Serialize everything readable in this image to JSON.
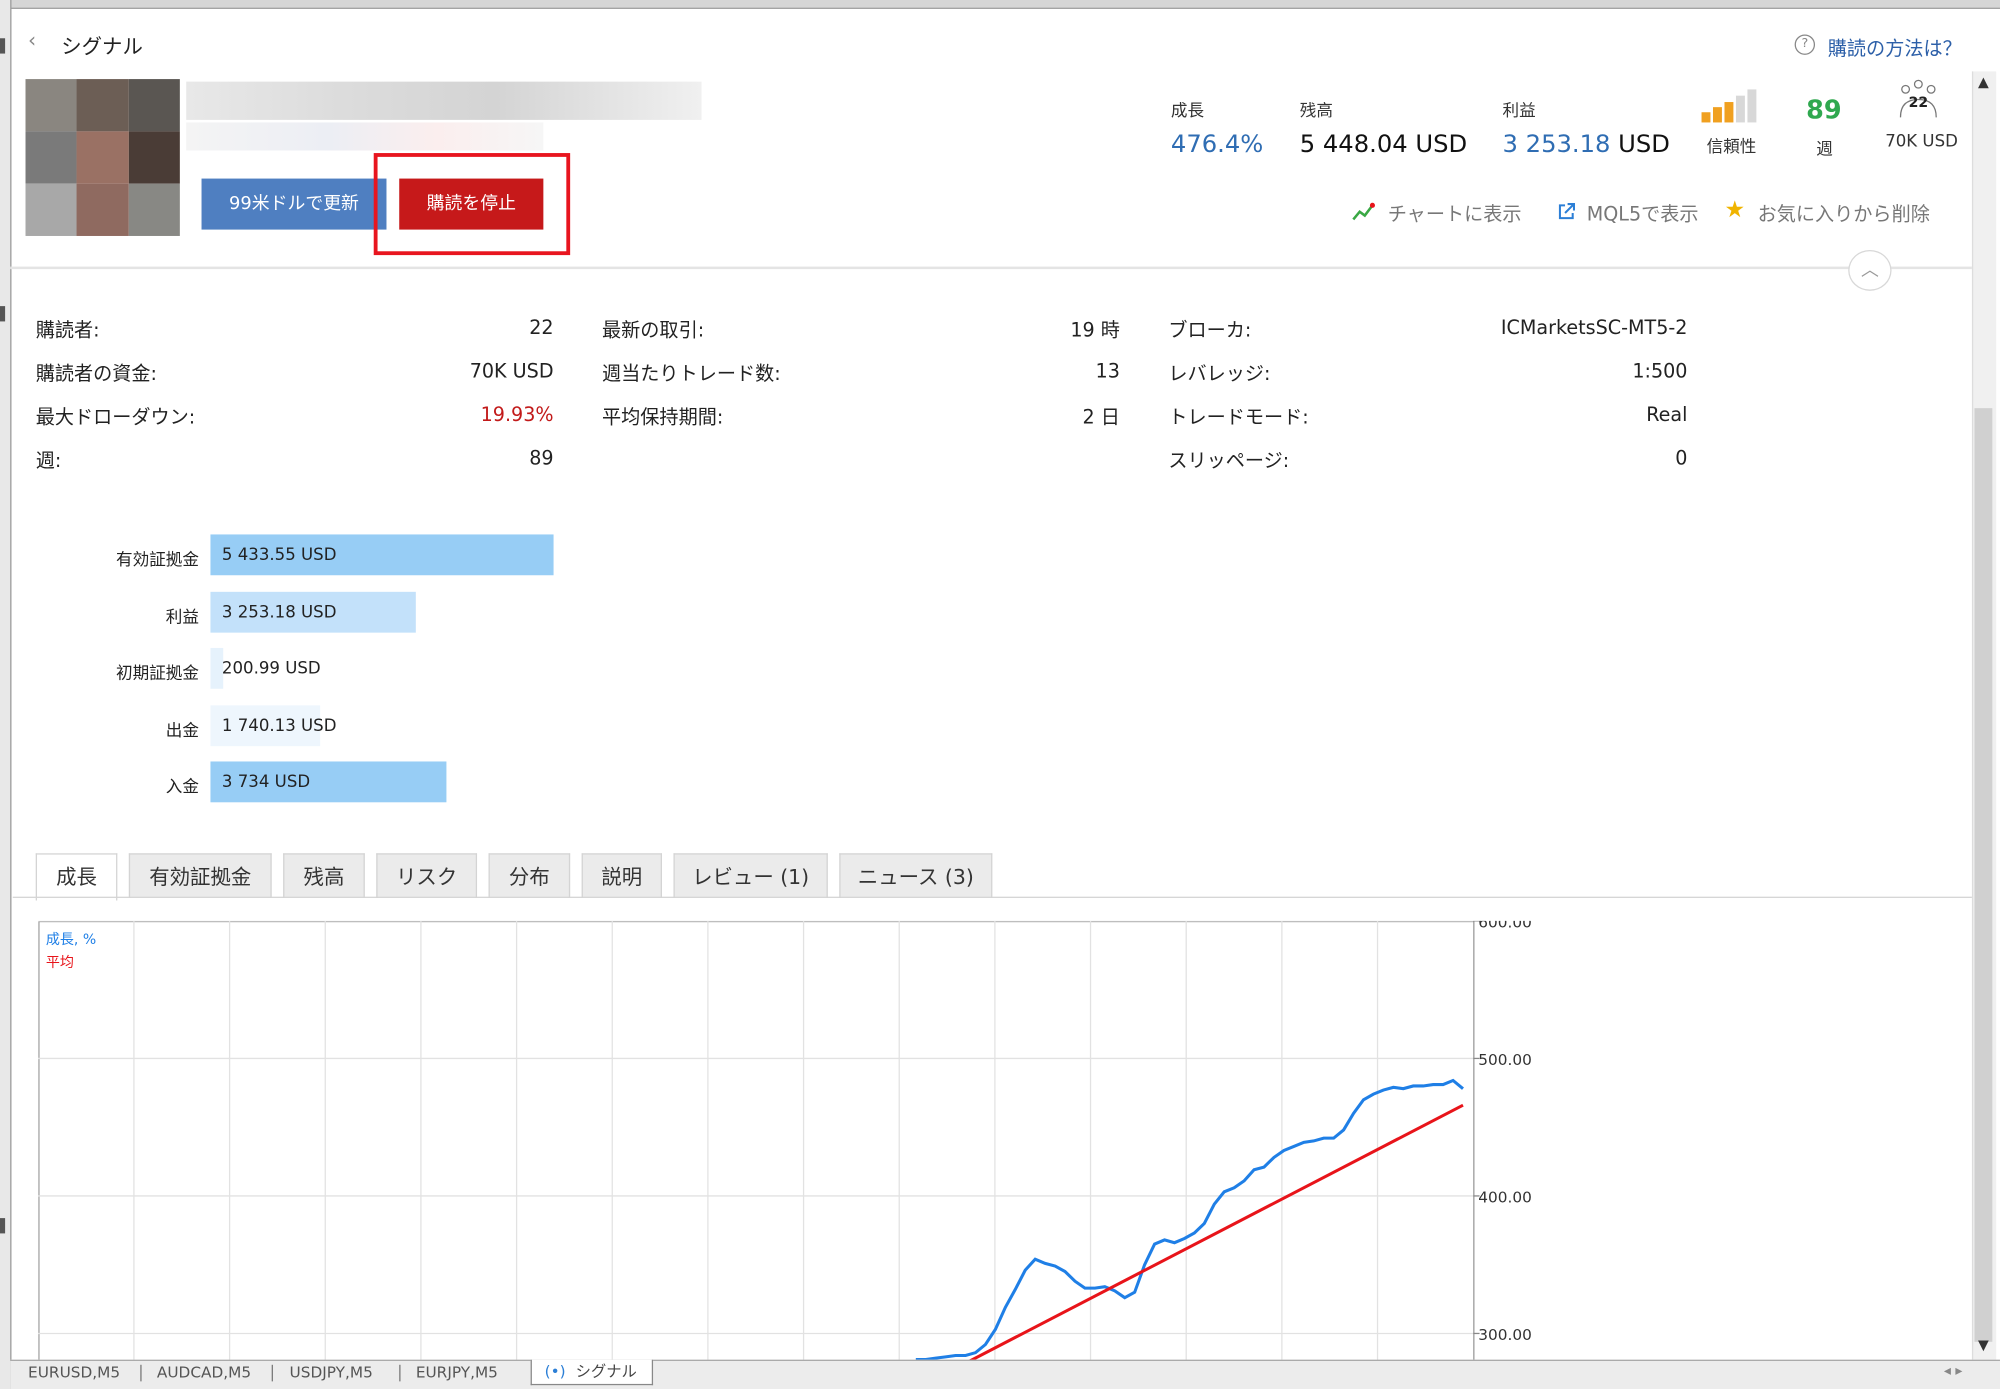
{
  "header": {
    "back_label": "シグナル",
    "howto_link": "購読の方法は？",
    "renew_button": "99米ドルで更新",
    "stop_button": "購読を停止"
  },
  "stats": {
    "growth_label": "成長",
    "growth_value": "476.4%",
    "balance_label": "残高",
    "balance_value": "5 448.04 USD",
    "profit_label": "利益",
    "profit_number": "3 253.18",
    "profit_currency": "USD",
    "reliability_label": "信頼性",
    "weeks_value": "89",
    "weeks_label": "週",
    "subscribers_count": "22",
    "subscribers_funds": "70K USD"
  },
  "actions": {
    "chart_show": "チャートに表示",
    "mql5_show": "MQL5で表示",
    "favorite_remove": "お気に入りから削除"
  },
  "info": {
    "col1": [
      {
        "label": "購読者:",
        "value": "22"
      },
      {
        "label": "購読者の資金:",
        "value": "70K USD"
      },
      {
        "label": "最大ドローダウン:",
        "value": "19.93%"
      },
      {
        "label": "週:",
        "value": "89"
      }
    ],
    "col2": [
      {
        "label": "最新の取引:",
        "value": "19 時"
      },
      {
        "label": "週当たりトレード数:",
        "value": "13"
      },
      {
        "label": "平均保持期間:",
        "value": "2 日"
      }
    ],
    "col3": [
      {
        "label": "ブローカ:",
        "value": "ICMarketsSC-MT5-2"
      },
      {
        "label": "レバレッジ:",
        "value": "1:500"
      },
      {
        "label": "トレードモード:",
        "value": "Real"
      },
      {
        "label": "スリッページ:",
        "value": "0"
      }
    ]
  },
  "bars": [
    {
      "label": "有効証拠金",
      "value": "5 433.55 USD",
      "amount": 5433.55,
      "color": "#97cdf5"
    },
    {
      "label": "利益",
      "value": "3 253.18 USD",
      "amount": 3253.18,
      "color": "#c3e1fa"
    },
    {
      "label": "初期証拠金",
      "value": "200.99 USD",
      "amount": 200.99,
      "color": "#e6f2fc"
    },
    {
      "label": "出金",
      "value": "1 740.13 USD",
      "amount": 1740.13,
      "color": "#eef6fd"
    },
    {
      "label": "入金",
      "value": "3 734 USD",
      "amount": 3734,
      "color": "#97cdf5"
    }
  ],
  "tabs": [
    "成長",
    "有効証拠金",
    "残高",
    "リスク",
    "分布",
    "説明",
    "レビュー (1)",
    "ニュース (3)"
  ],
  "chart_data": {
    "type": "line",
    "ylim": [
      280,
      600
    ],
    "yticks": [
      "600.00",
      "500.00",
      "400.00",
      "300.00"
    ],
    "ytick_values": [
      600,
      500,
      400,
      300
    ],
    "legend": [
      "成長, %",
      "平均"
    ],
    "series": [
      {
        "name": "成長, %",
        "color": "#1f7fe6",
        "values": [
          281,
          281,
          282,
          283,
          284,
          284,
          286,
          292,
          303,
          319,
          332,
          346,
          354,
          351,
          349,
          345,
          338,
          333,
          333,
          334,
          331,
          326,
          330,
          350,
          365,
          368,
          366,
          369,
          373,
          380,
          394,
          403,
          406,
          411,
          419,
          421,
          428,
          433,
          436,
          439,
          440,
          442,
          442,
          448,
          460,
          470,
          474,
          477,
          479,
          478,
          480,
          480,
          481,
          481,
          484,
          478
        ]
      },
      {
        "name": "平均",
        "color": "#e8141a",
        "values": [
          275,
          466
        ]
      }
    ]
  },
  "bottom_tabs": [
    "EURUSD,M5",
    "AUDCAD,M5",
    "USDJPY,M5",
    "EURJPY,M5",
    "シグナル"
  ],
  "colors": {
    "accent_blue": "#4f7fc1",
    "stop_red": "#c6191a",
    "highlight_red": "#e8151f",
    "growth_blue": "#2f6db3",
    "drawdown_red": "#c21a1a",
    "weeks_green": "#2fa84f",
    "reliability_orange": "#f0a020"
  }
}
